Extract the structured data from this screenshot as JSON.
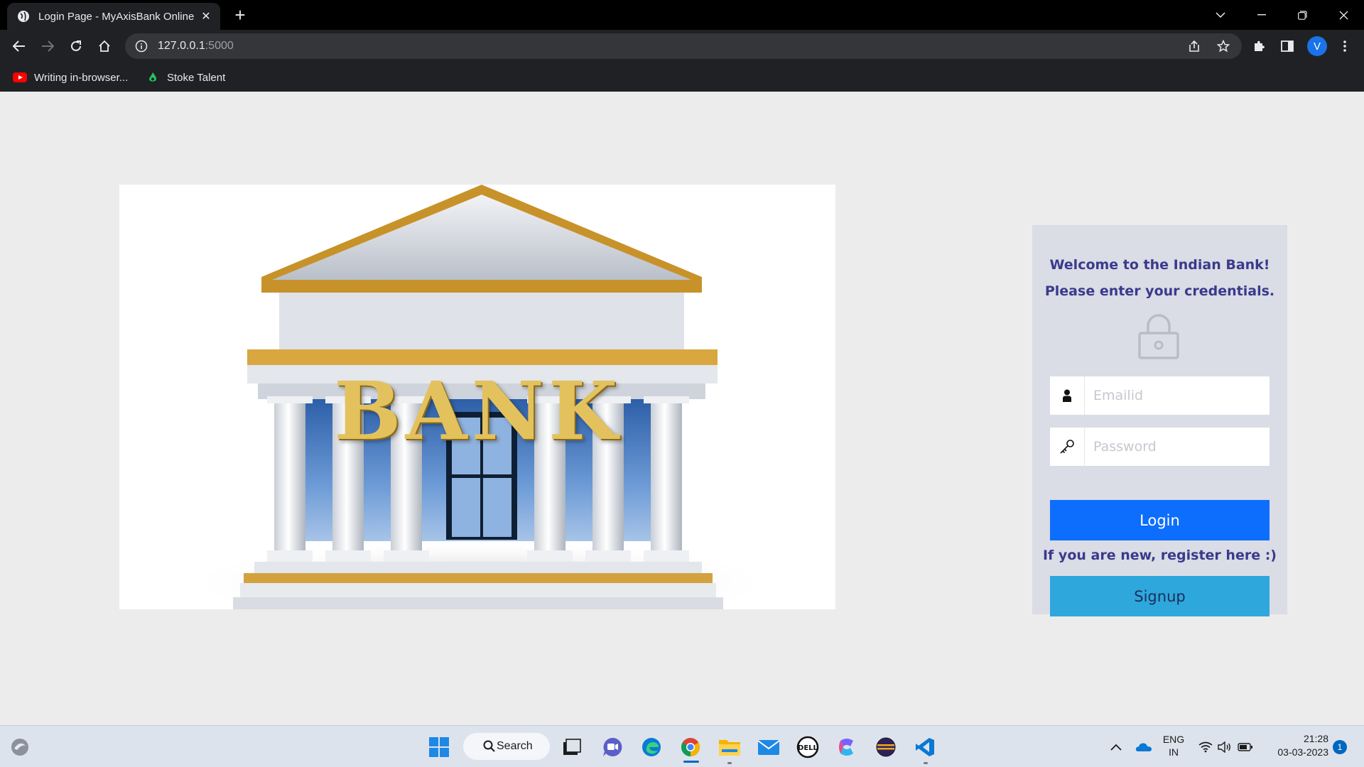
{
  "browser": {
    "tab_title": "Login Page - MyAxisBank Online",
    "tab_close": "✕",
    "new_tab": "+",
    "url_host": "127.0.0.1",
    "url_port": ":5000",
    "profile_initial": "V",
    "bookmarks": [
      {
        "label": "Writing in-browser...",
        "icon": "youtube-icon"
      },
      {
        "label": "Stoke Talent",
        "icon": "stoke-talent-icon"
      }
    ]
  },
  "page": {
    "hero_image_text": "BANK",
    "welcome_line1": "Welcome to the Indian Bank!",
    "welcome_line2": "Please enter your credentials.",
    "email_placeholder": "Emailid",
    "password_placeholder": "Password",
    "login_label": "Login",
    "register_text": "If you are new, register here :)",
    "signup_label": "Signup",
    "colors": {
      "login_button": "#0d6efd",
      "signup_button": "#2ea7dd",
      "heading_text": "#3a3a8c",
      "card_background": "#dadce6"
    }
  },
  "taskbar": {
    "search_label": "Search",
    "language_line1": "ENG",
    "language_line2": "IN",
    "time": "21:28",
    "date": "03-03-2023",
    "notification_count": "1",
    "apps": [
      "start-icon",
      "task-view-icon",
      "chat-icon",
      "edge-icon",
      "chrome-icon",
      "file-explorer-icon",
      "mail-icon",
      "dell-icon",
      "copilot-icon",
      "eclipse-icon",
      "vscode-icon"
    ]
  }
}
